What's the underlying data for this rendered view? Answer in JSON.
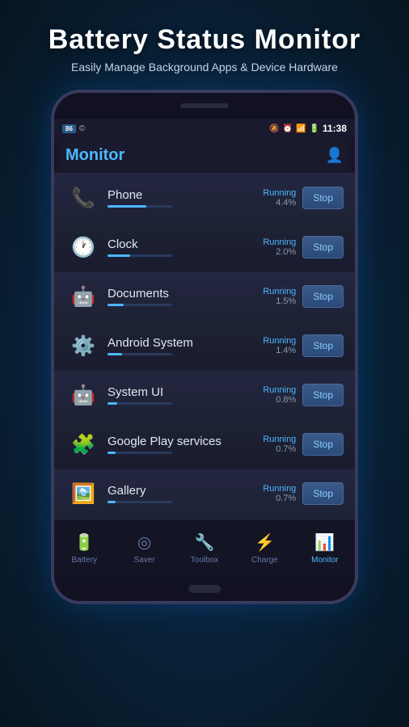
{
  "header": {
    "title": "Battery Status Monitor",
    "subtitle": "Easily Manage Background Apps & Device Hardware"
  },
  "status_bar": {
    "badge1": "86",
    "time": "11:38"
  },
  "app": {
    "title": "Monitor"
  },
  "apps": [
    {
      "name": "Phone",
      "status": "Running",
      "percent": "4.4%",
      "progress": 60,
      "icon": "📞",
      "icon_color": "#4488ff"
    },
    {
      "name": "Clock",
      "status": "Running",
      "percent": "2.0%",
      "progress": 35,
      "icon": "🕐",
      "icon_color": "#cccccc"
    },
    {
      "name": "Documents",
      "status": "Running",
      "percent": "1.5%",
      "progress": 25,
      "icon": "🤖",
      "icon_color": "#88cc44"
    },
    {
      "name": "Android System",
      "status": "Running",
      "percent": "1.4%",
      "progress": 22,
      "icon": "⚙️",
      "icon_color": "#aaddaa"
    },
    {
      "name": "System UI",
      "status": "Running",
      "percent": "0.8%",
      "progress": 15,
      "icon": "🤖",
      "icon_color": "#ee4444"
    },
    {
      "name": "Google Play services",
      "status": "Running",
      "percent": "0.7%",
      "progress": 12,
      "icon": "🧩",
      "icon_color": "#cc44ff"
    },
    {
      "name": "Gallery",
      "status": "Running",
      "percent": "0.7%",
      "progress": 12,
      "icon": "🖼️",
      "icon_color": "#ff8844"
    }
  ],
  "buttons": {
    "stop": "Stop"
  },
  "nav": [
    {
      "label": "Battery",
      "icon": "🔋",
      "active": false
    },
    {
      "label": "Saver",
      "icon": "◎",
      "active": false
    },
    {
      "label": "Toolbox",
      "icon": "🔧",
      "active": false
    },
    {
      "label": "Charge",
      "icon": "⚡",
      "active": false
    },
    {
      "label": "Monitor",
      "icon": "📊",
      "active": true
    }
  ]
}
